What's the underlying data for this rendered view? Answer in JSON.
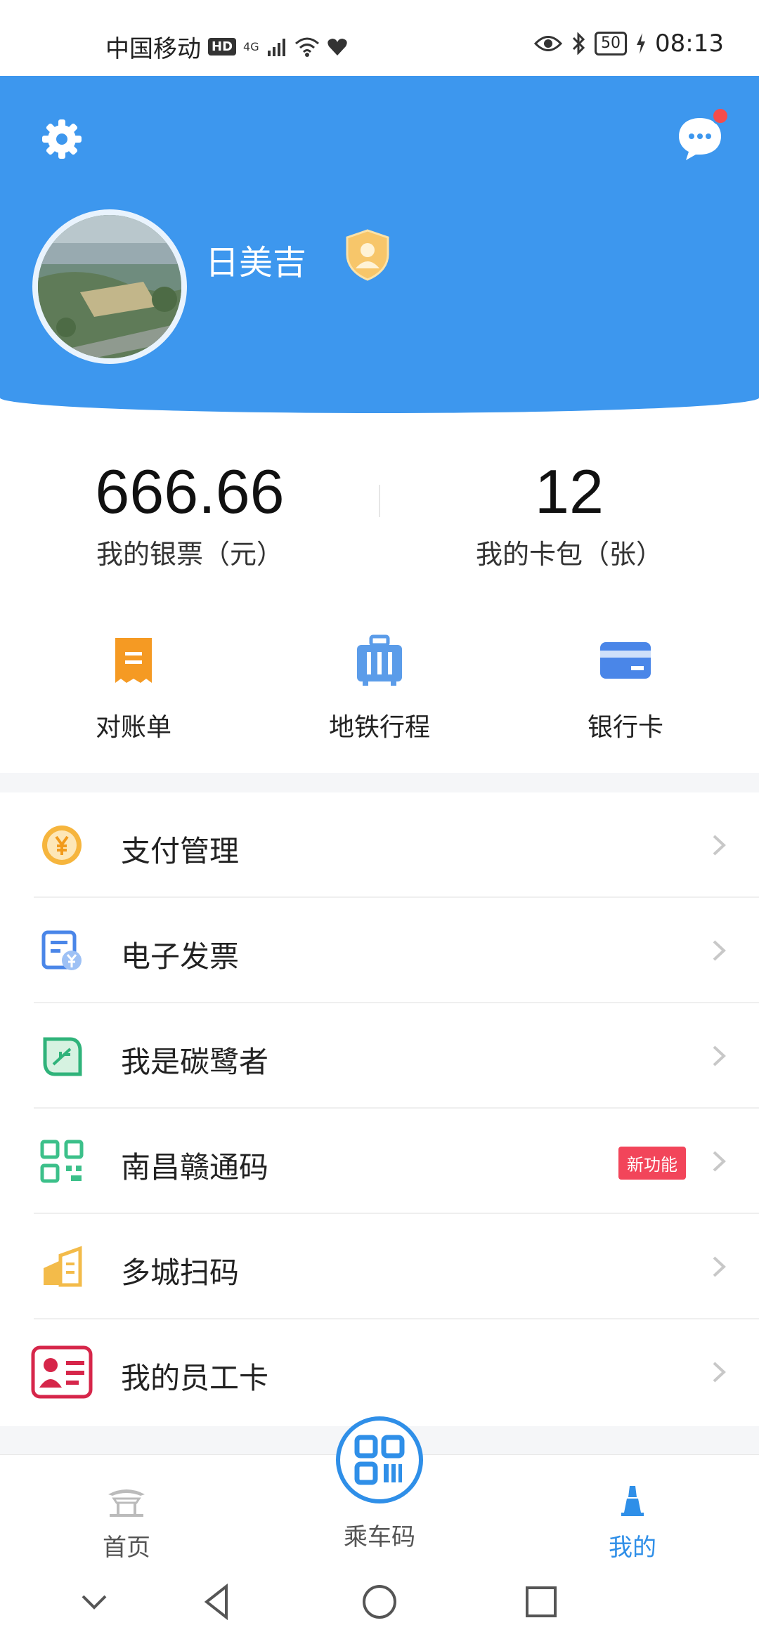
{
  "status_bar": {
    "carrier": "中国移动",
    "hd": "HD",
    "network": "4G",
    "battery": "50",
    "time": "08:13"
  },
  "header": {
    "username": "日美吉",
    "background_color": "#3d97ee"
  },
  "stats": [
    {
      "value": "666.66",
      "label": "我的银票（元）"
    },
    {
      "value": "12",
      "label": "我的卡包（张）"
    }
  ],
  "quick_actions": [
    {
      "label": "对账单",
      "icon": "statement-icon",
      "color": "#f59a23"
    },
    {
      "label": "地铁行程",
      "icon": "luggage-icon",
      "color": "#5b9ce9"
    },
    {
      "label": "银行卡",
      "icon": "bank-card-icon",
      "color": "#4a86e8"
    }
  ],
  "menu": [
    {
      "label": "支付管理",
      "icon": "yuan-coin-icon",
      "badge": ""
    },
    {
      "label": "电子发票",
      "icon": "invoice-icon",
      "badge": ""
    },
    {
      "label": "我是碳鹭者",
      "icon": "leaf-icon",
      "badge": ""
    },
    {
      "label": "南昌赣通码",
      "icon": "qr-code-icon",
      "badge": "新功能"
    },
    {
      "label": "多城扫码",
      "icon": "city-icon",
      "badge": ""
    },
    {
      "label": "我的员工卡",
      "icon": "employee-card-icon",
      "badge": ""
    }
  ],
  "bottom_nav": {
    "home": "首页",
    "ride_code": "乘车码",
    "mine": "我的",
    "active": "mine",
    "accent_color": "#2f8fe8"
  }
}
